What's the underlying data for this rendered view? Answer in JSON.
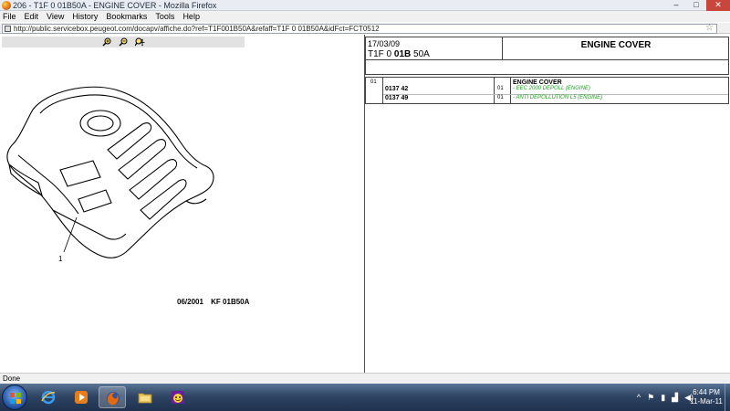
{
  "window": {
    "title": "206 - T1F 0 01B50A - ENGINE COVER - Mozilla Firefox",
    "controls": {
      "minimize": "–",
      "maximize": "□",
      "close": "✕"
    }
  },
  "menu": [
    "File",
    "Edit",
    "View",
    "History",
    "Bookmarks",
    "Tools",
    "Help"
  ],
  "address": {
    "url": "http://public.servicebox.peugeot.com/docapv/affiche.do?ref=T1F001B50A&refaff=T1F 0 01B50A&idFct=FCT0512",
    "bookmark_star": "☆"
  },
  "diagram": {
    "callout": "1",
    "date_label": "06/2001",
    "code_label": "KF 01B50A",
    "zoom_tools": [
      "zoom-in",
      "zoom-out",
      "zoom-move"
    ]
  },
  "part_header": {
    "date": "17/03/09",
    "ref_prefix": "T1F 0 ",
    "ref_bold": "01B",
    "ref_suffix": " 50A",
    "title": "ENGINE COVER"
  },
  "parts": {
    "item": "01",
    "group_name": "ENGINE COVER",
    "rows": [
      {
        "part_no": "0137 42",
        "qty": "01",
        "desc": "- EEC 2000 DEPOLL (ENGINE)"
      },
      {
        "part_no": "0137 49",
        "qty": "01",
        "desc": "- ANTI DEPOLLUTION L5 (ENGINE)"
      }
    ]
  },
  "status": {
    "text": "Done"
  },
  "taskbar": {
    "apps": [
      "internet-explorer",
      "media-player",
      "firefox",
      "folder",
      "yahoo-messenger"
    ],
    "tray": [
      "^",
      "flag",
      "battery",
      "network",
      "volume"
    ],
    "time": "6:44 PM",
    "date": "11-Mar-11"
  },
  "colors": {
    "desc_green": "#1e9e1e",
    "taskbar": "#2f4563",
    "close_red": "#c9463d"
  }
}
